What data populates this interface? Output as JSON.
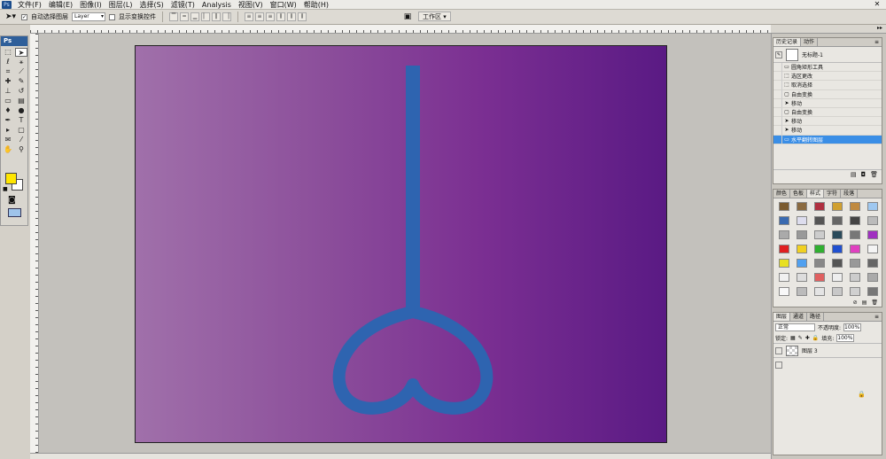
{
  "menubar": {
    "logo": "Ps",
    "items": [
      "文件(F)",
      "编辑(E)",
      "图像(I)",
      "图层(L)",
      "选择(S)",
      "滤镜(T)",
      "Analysis",
      "视图(V)",
      "窗口(W)",
      "帮助(H)"
    ]
  },
  "options": {
    "auto_select_label": "自动选择图层",
    "auto_select_value": "Layer",
    "show_transform_label": "显示变换控件",
    "workspace_label": "工作区 ▾"
  },
  "toolbox": {
    "badge": "Ps",
    "foreground_color": "#ffe600",
    "background_color": "#ffffff"
  },
  "canvas": {
    "gradient_start": "#a070aa",
    "gradient_end": "#5a1a84",
    "shape_color": "#2e64b0"
  },
  "history": {
    "tabs": [
      "历史记录",
      "动作"
    ],
    "snapshot_label": "无标题-1",
    "items": [
      "圆角矩形工具",
      "选区更改",
      "取消选择",
      "自由变换",
      "移动",
      "自由变换",
      "移动",
      "移动",
      "水平翻转图层"
    ]
  },
  "styles": {
    "tabs": [
      "颜色",
      "色板",
      "样式",
      "字符",
      "段落"
    ]
  },
  "layers": {
    "tabs": [
      "图层",
      "通道",
      "路径"
    ],
    "blend_mode": "正常",
    "opacity_label": "不透明度:",
    "opacity_value": "100%",
    "lock_label": "锁定:",
    "fill_label": "填充:",
    "fill_value": "100%",
    "layer_name": "图层 3"
  }
}
